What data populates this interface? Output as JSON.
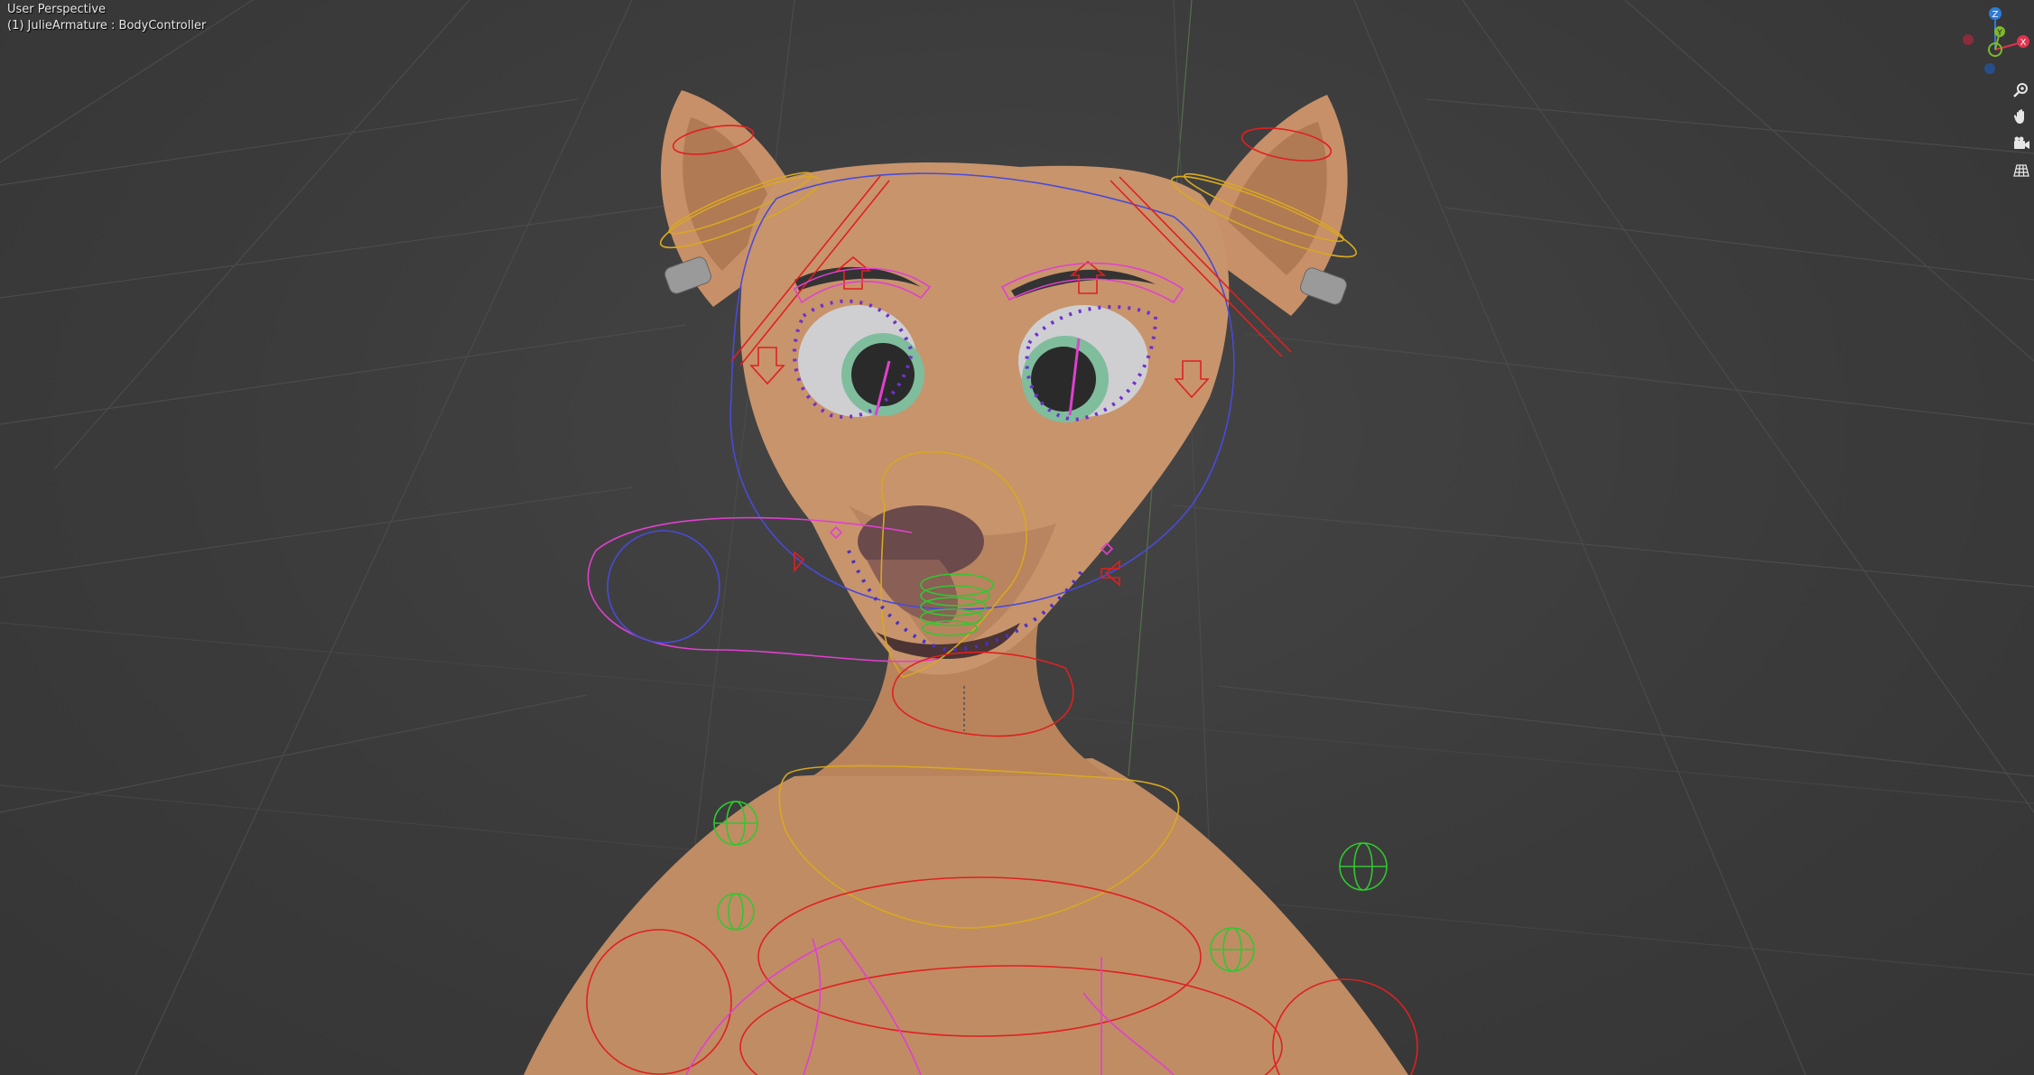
{
  "viewport": {
    "view_name": "User Perspective",
    "active_object": "(1) JulieArmature : BodyController"
  },
  "gizmo": {
    "axes": [
      {
        "label": "Z",
        "color": "#2f7bd6"
      },
      {
        "label": "Y",
        "color": "#7fb82a"
      },
      {
        "label": "X",
        "color": "#e0334f"
      }
    ]
  },
  "nav_buttons": [
    {
      "name": "zoom-icon"
    },
    {
      "name": "pan-hand-icon"
    },
    {
      "name": "camera-view-icon"
    },
    {
      "name": "ortho-grid-icon"
    }
  ],
  "colors": {
    "skin": "#c8946c",
    "skin_shadow": "#a7744f",
    "grid": "#4a4a4a",
    "bone_red": "#e02020",
    "bone_yellow": "#d8a820",
    "bone_blue": "#4a4ad8",
    "bone_pink": "#e040d0",
    "bone_green": "#30c830"
  }
}
